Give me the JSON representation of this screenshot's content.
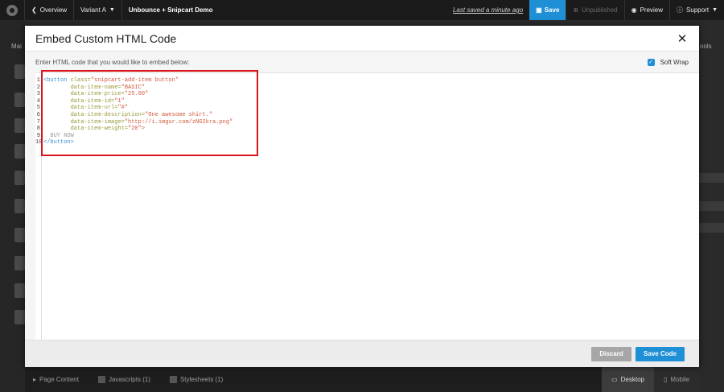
{
  "topbar": {
    "overview": "Overview",
    "variant": "Variant A",
    "page_title": "Unbounce + Snipcart Demo",
    "last_saved": "Last saved  a minute ago",
    "save": "Save",
    "unpublished": "Unpublished",
    "preview": "Preview",
    "support": "Support"
  },
  "background": {
    "left_tab": "Mai",
    "right_tab": "ools",
    "bottom_tabs": [
      "Page Content",
      "Javascripts (1)",
      "Stylesheets (1)"
    ],
    "devices": [
      "Desktop",
      "Mobile"
    ]
  },
  "modal": {
    "title": "Embed Custom HTML Code",
    "instruction": "Enter HTML code that you would like to embed below:",
    "soft_wrap_label": "Soft Wrap",
    "soft_wrap_checked": true,
    "discard": "Discard",
    "save_code": "Save Code"
  },
  "code": {
    "line_numbers": [
      "1",
      "2",
      "3",
      "4",
      "5",
      "6",
      "7",
      "8",
      "9",
      "10"
    ],
    "lines": [
      [
        "<button",
        " class=",
        "\"snipcart-add-item button\""
      ],
      [
        "",
        "        data-item-name=",
        "\"BASIC\""
      ],
      [
        "",
        "        data-item-price=",
        "\"25.00\""
      ],
      [
        "",
        "        data-item-id=",
        "\"1\""
      ],
      [
        "",
        "        data-item-url=",
        "\"#\""
      ],
      [
        "",
        "        data-item-description=",
        "\"One awesome shirt.\""
      ],
      [
        "",
        "        data-item-image=",
        "\"http://i.imgur.com/zNG2kra.png\""
      ],
      [
        "",
        "        data-item-weight=",
        "\"20\">"
      ],
      [
        "",
        "",
        "  BUY NOW"
      ],
      [
        "</button>",
        "",
        ""
      ]
    ]
  },
  "colors": {
    "accent": "#1f8fd6",
    "highlight": "#d7141a",
    "tag": "#3a8fd0",
    "attr": "#999a3a",
    "string": "#d2583c"
  }
}
